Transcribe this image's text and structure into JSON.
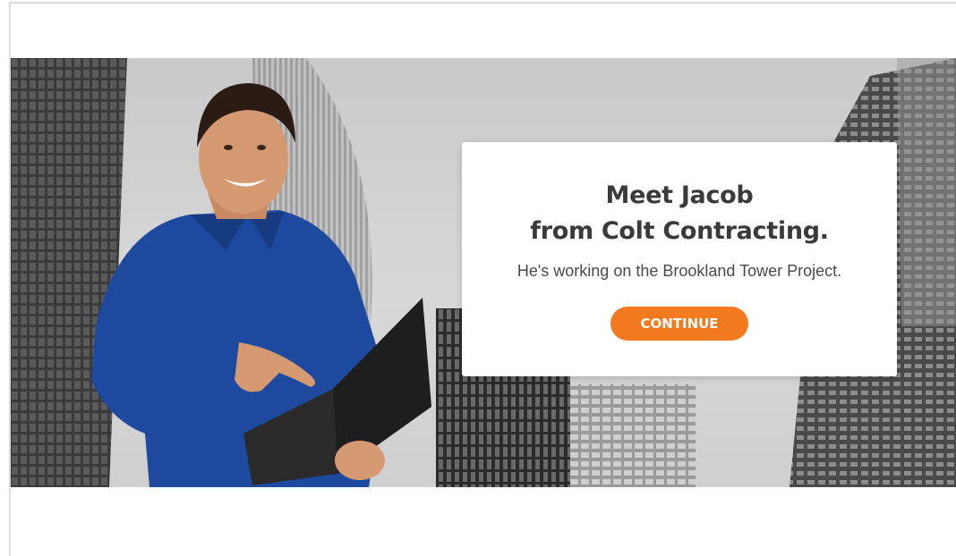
{
  "card": {
    "title_line1": "Meet Jacob",
    "title_line2": "from Colt Contracting.",
    "subtitle": "He's working on the Brookland Tower Project.",
    "button_label": "CONTINUE"
  },
  "colors": {
    "accent": "#f37a1f",
    "title": "#3a3a3a",
    "shirt": "#1d4a9e"
  }
}
